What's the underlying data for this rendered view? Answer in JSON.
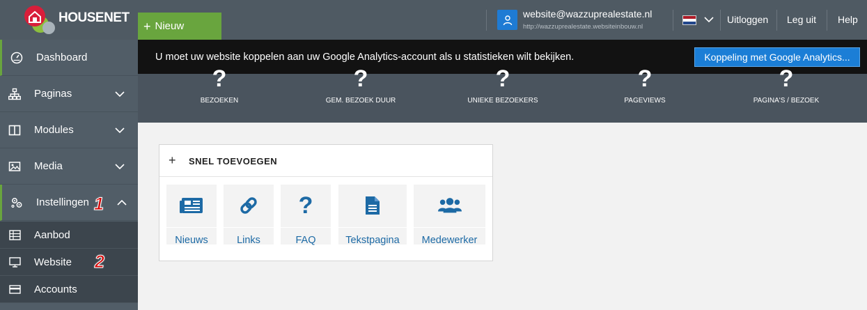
{
  "header": {
    "logo_text": "HOUSENET",
    "new_button": "Nieuw",
    "user_email": "website@wazzuprealestate.nl",
    "user_url": "http://wazzuprealestate.websiteinbouw.nl",
    "links": [
      "Uitloggen",
      "Leg uit",
      "Help"
    ]
  },
  "sidebar": {
    "items": [
      {
        "label": "Dashboard",
        "icon": "dashboard-icon",
        "active": true
      },
      {
        "label": "Paginas",
        "icon": "sitemap-icon"
      },
      {
        "label": "Modules",
        "icon": "columns-icon"
      },
      {
        "label": "Media",
        "icon": "image-icon"
      },
      {
        "label": "Instellingen",
        "icon": "settings-icon",
        "active": true,
        "expanded": true
      }
    ],
    "subitems": [
      {
        "label": "Aanbod",
        "icon": "table-icon"
      },
      {
        "label": "Website",
        "icon": "monitor-icon"
      },
      {
        "label": "Accounts",
        "icon": "credit-card-icon"
      }
    ],
    "markers": [
      "1",
      "2"
    ]
  },
  "analytics": {
    "message": "U moet uw website koppelen aan uw Google Analytics-account als u statistieken wilt bekijken.",
    "button": "Koppeling met Google Analytics..."
  },
  "stats": [
    {
      "value": "?",
      "label": "BEZOEKEN"
    },
    {
      "value": "?",
      "label": "GEM. BEZOEK DUUR"
    },
    {
      "value": "?",
      "label": "UNIEKE BEZOEKERS"
    },
    {
      "value": "?",
      "label": "PAGEVIEWS"
    },
    {
      "value": "?",
      "label": "PAGINA'S / BEZOEK"
    }
  ],
  "quick_add": {
    "title": "SNEL TOEVOEGEN",
    "tiles": [
      {
        "label": "Nieuws",
        "icon": "newspaper-icon"
      },
      {
        "label": "Links",
        "icon": "link-icon"
      },
      {
        "label": "FAQ",
        "icon": "question-icon"
      },
      {
        "label": "Tekstpagina",
        "icon": "document-icon"
      },
      {
        "label": "Medewerker",
        "icon": "users-icon"
      }
    ]
  },
  "colors": {
    "accent_green": "#69a53e",
    "accent_blue": "#1b7ed6",
    "sidebar": "#515d67",
    "tile_text": "#1d6aa5"
  }
}
